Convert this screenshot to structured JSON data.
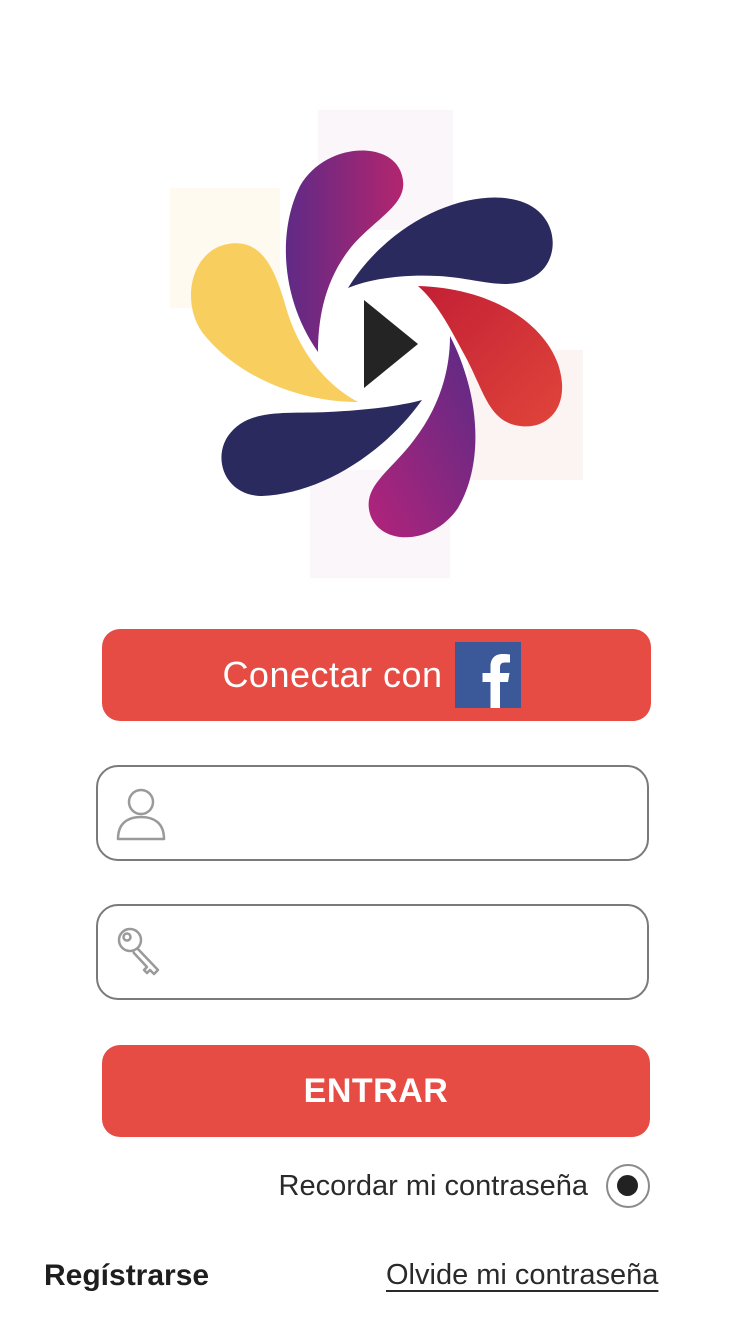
{
  "colors": {
    "accent": "#e74c44",
    "facebook": "#3b5998",
    "petal_navy": "#2b2a5e",
    "petal_purple": "#7a2a88",
    "petal_magenta": "#b0277a",
    "petal_red": "#d93534",
    "petal_yellow": "#f8cf5e"
  },
  "logo": {
    "icon": "pinwheel-play-logo"
  },
  "facebook_button": {
    "label": "Conectar con",
    "icon": "facebook-icon"
  },
  "username_field": {
    "icon": "user-icon",
    "value": "",
    "placeholder": ""
  },
  "password_field": {
    "icon": "key-icon",
    "value": "",
    "placeholder": ""
  },
  "enter_button": {
    "label": "ENTRAR"
  },
  "remember": {
    "label": "Recordar mi contraseña",
    "checked": true
  },
  "footer": {
    "register_label": "Regístrarse",
    "forgot_label": "Olvide mi contraseña"
  }
}
